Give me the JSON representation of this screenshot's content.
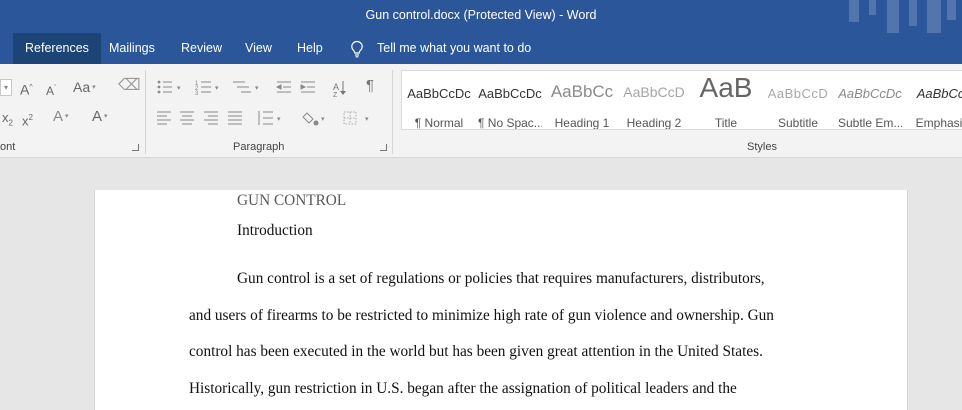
{
  "window": {
    "title": "Gun control.docx (Protected View)  -  Word"
  },
  "tabs": [
    {
      "label": "References",
      "active": true
    },
    {
      "label": "Mailings"
    },
    {
      "label": "Review"
    },
    {
      "label": "View"
    },
    {
      "label": "Help"
    }
  ],
  "tell_me": {
    "placeholder": "Tell me what you want to do"
  },
  "ribbon": {
    "font_group_label": "ont",
    "paragraph_group_label": "Paragraph",
    "styles_group_label": "Styles",
    "font_tools": {
      "grow": "A",
      "shrink": "A",
      "case": "Aa",
      "subscript": "x",
      "superscript": "x",
      "effects": "A",
      "color": "A"
    },
    "paragraph_tools": {
      "pilcrow": "¶",
      "sort": "A↓"
    },
    "styles": [
      {
        "sample": "AaBbCcDc",
        "name": "¶ Normal"
      },
      {
        "sample": "AaBbCcDc",
        "name": "¶ No Spac..."
      },
      {
        "sample": "AaBbCc",
        "name": "Heading 1"
      },
      {
        "sample": "AaBbCcD",
        "name": "Heading 2"
      },
      {
        "sample": "AaB",
        "name": "Title"
      },
      {
        "sample": "AaBbCcD",
        "name": "Subtitle"
      },
      {
        "sample": "AaBbCcDc",
        "name": "Subtle Em..."
      },
      {
        "sample": "AaBbCcl",
        "name": "Emphasis"
      }
    ]
  },
  "document": {
    "heading": "GUN CONTROL",
    "subheading": "Introduction",
    "lines": [
      "Gun control is a set of regulations or policies that requires manufacturers, distributors,",
      "and users of firearms to be restricted to minimize high rate of gun violence and ownership. Gun",
      "control has been executed in the world but has been given great attention in the United States.",
      "Historically, gun restriction in U.S. began after the assignation of political leaders and the"
    ]
  }
}
